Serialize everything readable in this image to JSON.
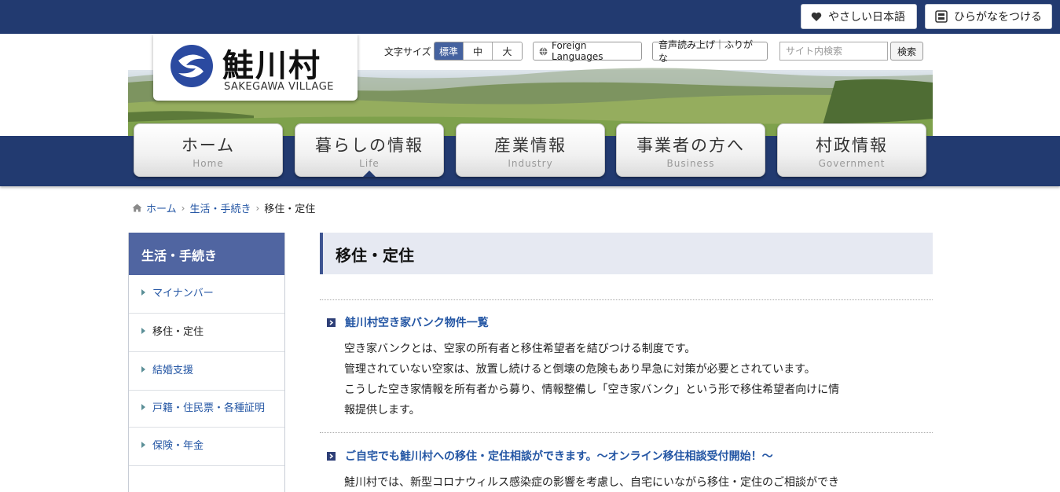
{
  "topbar": {
    "yasashii_label": "やさしい日本語",
    "hiragana_label": "ひらがなをつける"
  },
  "logo": {
    "name": "鮭川村",
    "name_en": "SAKEGAWA VILLAGE"
  },
  "tools": {
    "font_size_label": "文字サイズ",
    "font_sizes": [
      "標準",
      "中",
      "大"
    ],
    "foreign_languages": "Foreign Languages",
    "voice_label": "音声読み上げ｜ふりがな",
    "search_placeholder": "サイト内検索",
    "search_button": "検索"
  },
  "nav": [
    {
      "jp": "ホーム",
      "en": "Home"
    },
    {
      "jp": "暮らしの情報",
      "en": "Life"
    },
    {
      "jp": "産業情報",
      "en": "Industry"
    },
    {
      "jp": "事業者の方へ",
      "en": "Business"
    },
    {
      "jp": "村政情報",
      "en": "Government"
    }
  ],
  "breadcrumb": {
    "home": "ホーム",
    "parent": "生活・手続き",
    "current": "移住・定住"
  },
  "sidebar": {
    "title": "生活・手続き",
    "items": [
      {
        "label": "マイナンバー"
      },
      {
        "label": "移住・定住"
      },
      {
        "label": "結婚支援"
      },
      {
        "label": "戸籍・住民票・各種証明"
      },
      {
        "label": "保険・年金"
      }
    ]
  },
  "main": {
    "title": "移住・定住",
    "entries": [
      {
        "title": "鮭川村空き家バンク物件一覧",
        "lines": [
          "空き家バンクとは、空家の所有者と移住希望者を結びつける制度です。",
          "管理されていない空家は、放置し続けると倒壊の危険もあり早急に対策が必要とされています。",
          "こうした空き家情報を所有者から募り、情報整備し「空き家バンク」という形で移住希望者向けに情",
          "報提供します。"
        ]
      },
      {
        "title": "ご自宅でも鮭川村への移住・定住相談ができます。～オンライン移住相談受付開始！～",
        "lines": [
          "鮭川村では、新型コロナウィルス感染症の影響を考慮し、自宅にいながら移住・定住のご相談ができ"
        ]
      }
    ]
  },
  "colors": {
    "navy": "#223a70",
    "sidebar_head": "#5065a1",
    "link": "#2456a4",
    "title_bg": "#e6e9f2"
  }
}
